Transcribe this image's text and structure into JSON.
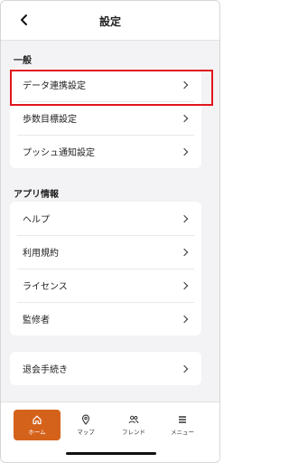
{
  "header": {
    "title": "設定",
    "back_icon": "chevron-left-icon"
  },
  "sections": {
    "general": {
      "label": "一般",
      "items": [
        {
          "label": "データ連携設定"
        },
        {
          "label": "歩数目標設定"
        },
        {
          "label": "プッシュ通知設定"
        }
      ]
    },
    "app_info": {
      "label": "アプリ情報",
      "items": [
        {
          "label": "ヘルプ"
        },
        {
          "label": "利用規約"
        },
        {
          "label": "ライセンス"
        },
        {
          "label": "監修者"
        }
      ]
    },
    "account": {
      "items": [
        {
          "label": "退会手続き"
        }
      ]
    }
  },
  "tabbar": {
    "tabs": [
      {
        "label": "ホーム",
        "icon": "home-icon",
        "active": true
      },
      {
        "label": "マップ",
        "icon": "map-pin-icon",
        "active": false
      },
      {
        "label": "フレンド",
        "icon": "friends-icon",
        "active": false
      },
      {
        "label": "メニュー",
        "icon": "menu-icon",
        "active": false
      }
    ]
  },
  "colors": {
    "accent": "#d5621b",
    "highlight_border": "#e0161c",
    "background": "#f3f3f5"
  }
}
